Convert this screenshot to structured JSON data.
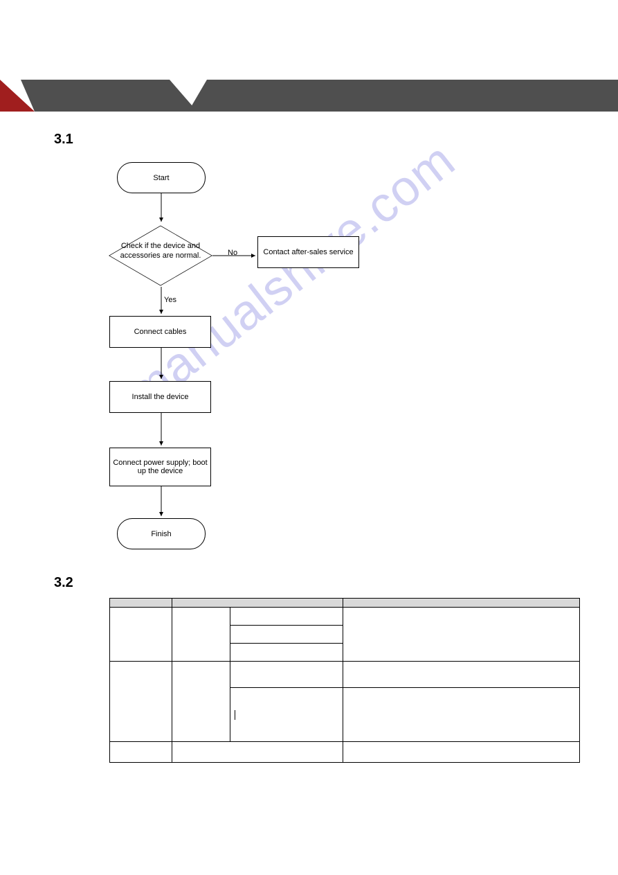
{
  "sections": {
    "s1": "3.1",
    "s2": "3.2"
  },
  "flowchart": {
    "start": "Start",
    "decision": "Check if the device and accessories are normal.",
    "yes": "Yes",
    "no": "No",
    "contact": "Contact after-sales service",
    "connect_cables": "Connect cables",
    "install": "Install the device",
    "power": "Connect power supply; boot up the device",
    "finish": "Finish"
  },
  "watermark": "manualshive.com",
  "chart_data": {
    "type": "flowchart",
    "nodes": [
      {
        "id": "start",
        "shape": "terminator",
        "label": "Start"
      },
      {
        "id": "check",
        "shape": "decision",
        "label": "Check if the device and accessories are normal."
      },
      {
        "id": "contact",
        "shape": "process",
        "label": "Contact after-sales service"
      },
      {
        "id": "cables",
        "shape": "process",
        "label": "Connect cables"
      },
      {
        "id": "install",
        "shape": "process",
        "label": "Install the device"
      },
      {
        "id": "power",
        "shape": "process",
        "label": "Connect power supply; boot up the device"
      },
      {
        "id": "finish",
        "shape": "terminator",
        "label": "Finish"
      }
    ],
    "edges": [
      {
        "from": "start",
        "to": "check"
      },
      {
        "from": "check",
        "to": "contact",
        "label": "No"
      },
      {
        "from": "check",
        "to": "cables",
        "label": "Yes"
      },
      {
        "from": "cables",
        "to": "install"
      },
      {
        "from": "install",
        "to": "power"
      },
      {
        "from": "power",
        "to": "finish"
      }
    ]
  },
  "table": {
    "rows": [
      {
        "c1": "",
        "c2": "",
        "c3": "",
        "c4": ""
      },
      {
        "c3_1": "",
        "c3_2": "",
        "c3_3": ""
      },
      {
        "c3a": "",
        "c4a": "",
        "c3b": "",
        "c4b": ""
      },
      {
        "c1": "",
        "c2": "",
        "c3": "",
        "c4": ""
      }
    ]
  }
}
